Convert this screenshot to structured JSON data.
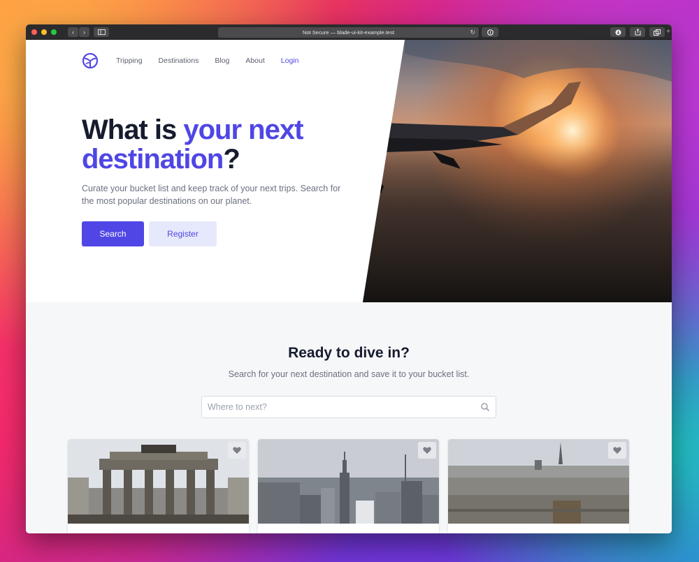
{
  "browser": {
    "url_text": "Not Secure — blade-ui-kit-example.test"
  },
  "nav": {
    "items": [
      "Tripping",
      "Destinations",
      "Blog",
      "About"
    ],
    "login": "Login"
  },
  "hero": {
    "headline_part1": "What is ",
    "headline_accent": "your next destination",
    "headline_end": "?",
    "subtext": "Curate your bucket list and keep track of your next trips. Search for the most popular destinations on our planet.",
    "primary_button": "Search",
    "secondary_button": "Register"
  },
  "dive": {
    "title": "Ready to dive in?",
    "subtitle": "Search for your next destination and save it to your bucket list.",
    "search_placeholder": "Where to next?"
  },
  "cards": [
    {
      "image": "brandenburg-gate-photo",
      "icon": "heart-icon"
    },
    {
      "image": "new-york-skyline-photo",
      "icon": "heart-icon"
    },
    {
      "image": "paris-skyline-photo",
      "icon": "heart-icon"
    }
  ],
  "colors": {
    "accent": "#4f46e5",
    "heading": "#161b2e",
    "muted": "#6b7080",
    "section_bg": "#f6f7f9"
  }
}
